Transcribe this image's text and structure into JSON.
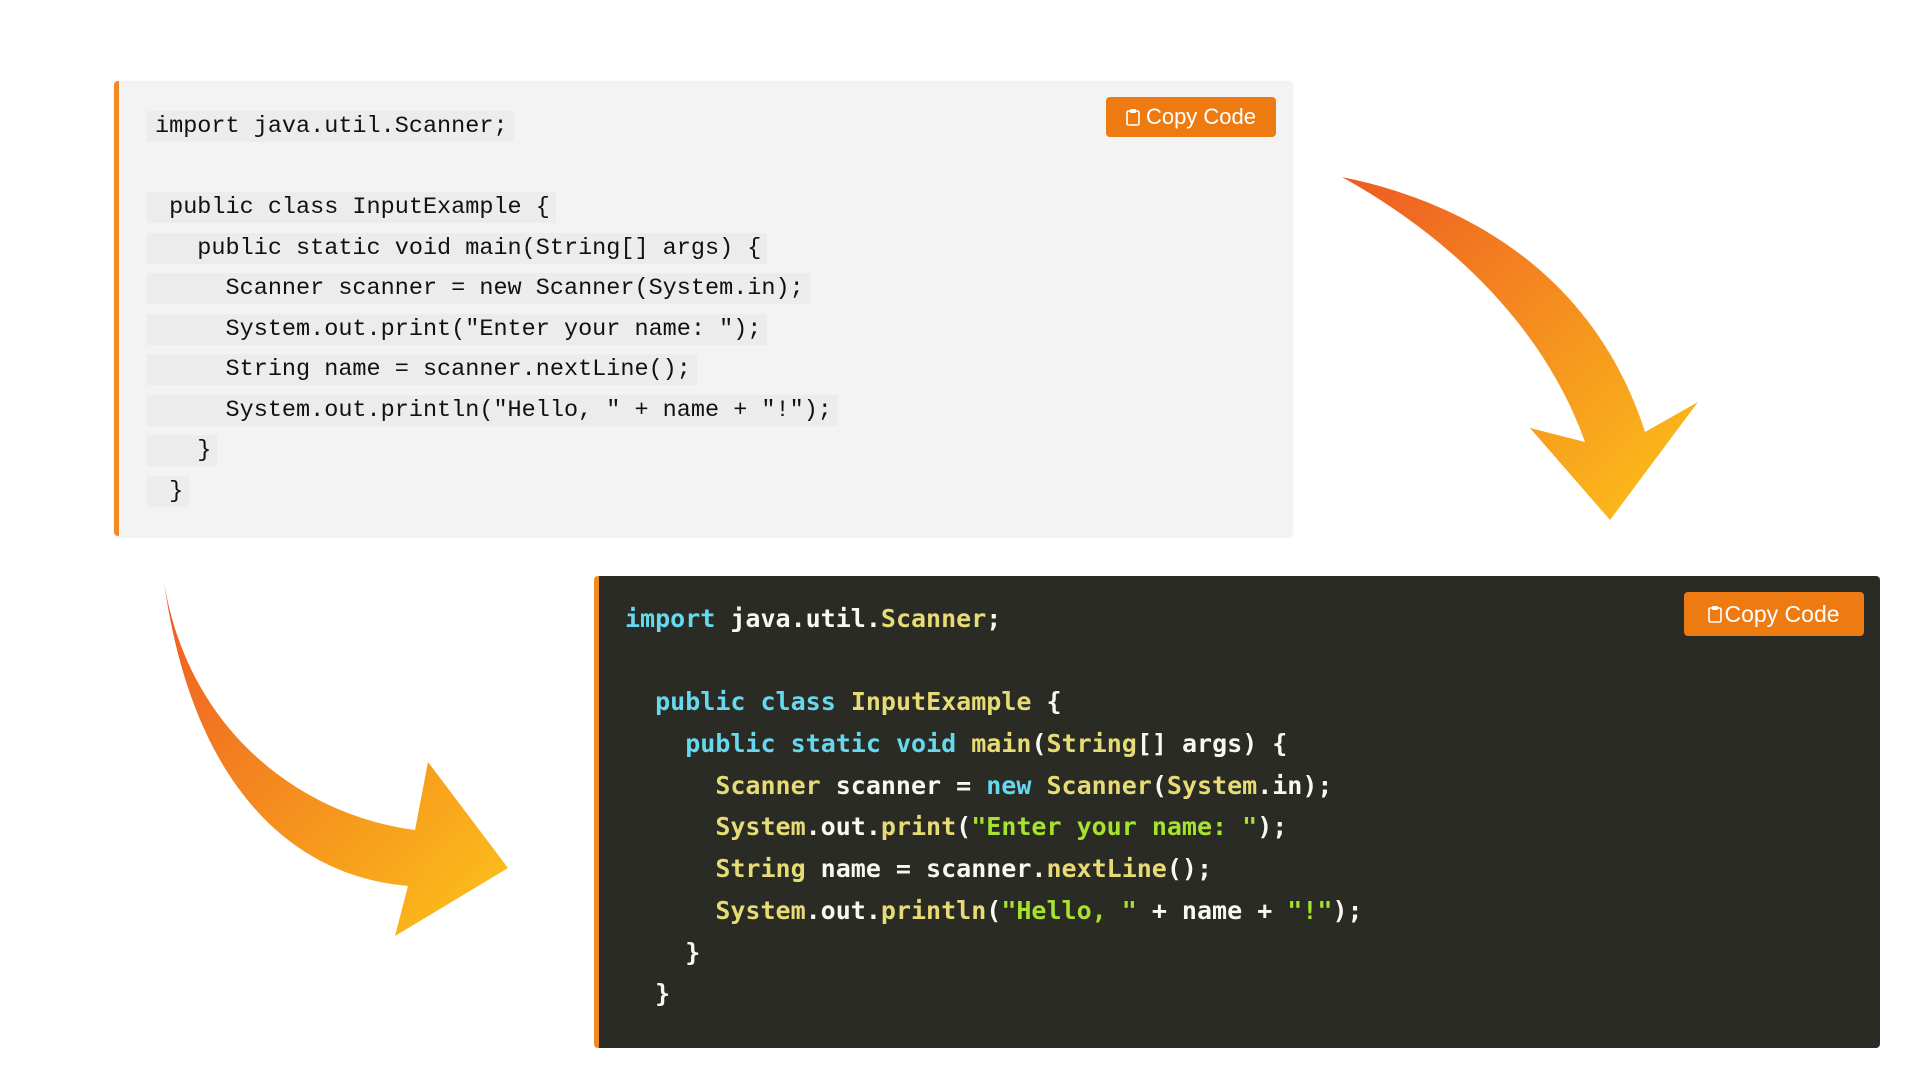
{
  "light_block": {
    "copy_label": "Copy Code",
    "lines": [
      "import java.util.Scanner;",
      "",
      " public class InputExample {",
      "   public static void main(String[] args) {",
      "     Scanner scanner = new Scanner(System.in);",
      "     System.out.print(\"Enter your name: \");",
      "     String name = scanner.nextLine();",
      "     System.out.println(\"Hello, \" + name + \"!\");",
      "   }",
      " }"
    ]
  },
  "dark_block": {
    "copy_label": "Copy Code",
    "tokens": [
      [
        [
          "kw",
          "import"
        ],
        [
          "pl",
          " java.util."
        ],
        [
          "ty",
          "Scanner"
        ],
        [
          "pl",
          ";"
        ]
      ],
      [],
      [
        [
          "pl",
          "  "
        ],
        [
          "kw",
          "public"
        ],
        [
          "pl",
          " "
        ],
        [
          "kw",
          "class"
        ],
        [
          "pl",
          " "
        ],
        [
          "ty",
          "InputExample"
        ],
        [
          "pl",
          " {"
        ]
      ],
      [
        [
          "pl",
          "    "
        ],
        [
          "kw",
          "public"
        ],
        [
          "pl",
          " "
        ],
        [
          "kw",
          "static"
        ],
        [
          "pl",
          " "
        ],
        [
          "kw",
          "void"
        ],
        [
          "pl",
          " "
        ],
        [
          "ty",
          "main"
        ],
        [
          "pl",
          "("
        ],
        [
          "ty",
          "String"
        ],
        [
          "pl",
          "[] args) {"
        ]
      ],
      [
        [
          "pl",
          "      "
        ],
        [
          "ty",
          "Scanner"
        ],
        [
          "pl",
          " scanner = "
        ],
        [
          "kw",
          "new"
        ],
        [
          "pl",
          " "
        ],
        [
          "ty",
          "Scanner"
        ],
        [
          "pl",
          "("
        ],
        [
          "ty",
          "System"
        ],
        [
          "pl",
          ".in);"
        ]
      ],
      [
        [
          "pl",
          "      "
        ],
        [
          "ty",
          "System"
        ],
        [
          "pl",
          ".out."
        ],
        [
          "ty",
          "print"
        ],
        [
          "pl",
          "("
        ],
        [
          "st",
          "\"Enter your name: \""
        ],
        [
          "pl",
          ");"
        ]
      ],
      [
        [
          "pl",
          "      "
        ],
        [
          "ty",
          "String"
        ],
        [
          "pl",
          " name = scanner."
        ],
        [
          "ty",
          "nextLine"
        ],
        [
          "pl",
          "();"
        ]
      ],
      [
        [
          "pl",
          "      "
        ],
        [
          "ty",
          "System"
        ],
        [
          "pl",
          ".out."
        ],
        [
          "ty",
          "println"
        ],
        [
          "pl",
          "("
        ],
        [
          "st",
          "\"Hello, \""
        ],
        [
          "pl",
          " + name + "
        ],
        [
          "st",
          "\"!\""
        ],
        [
          "pl",
          ");"
        ]
      ],
      [
        [
          "pl",
          "    }"
        ]
      ],
      [
        [
          "pl",
          "  }"
        ]
      ]
    ]
  },
  "colors": {
    "accent": "#ee7a12",
    "arrow_start": "#ee5a24",
    "arrow_end": "#fcc419",
    "dark_bg": "#2b2b25",
    "light_bg": "#f3f3f3",
    "keyword": "#66d9ef",
    "type": "#e6db74",
    "string": "#a6e22e"
  },
  "icons": {
    "copy": "clipboard-icon",
    "arrow_top": "curved-arrow-down-icon",
    "arrow_bottom": "curved-arrow-right-icon"
  }
}
